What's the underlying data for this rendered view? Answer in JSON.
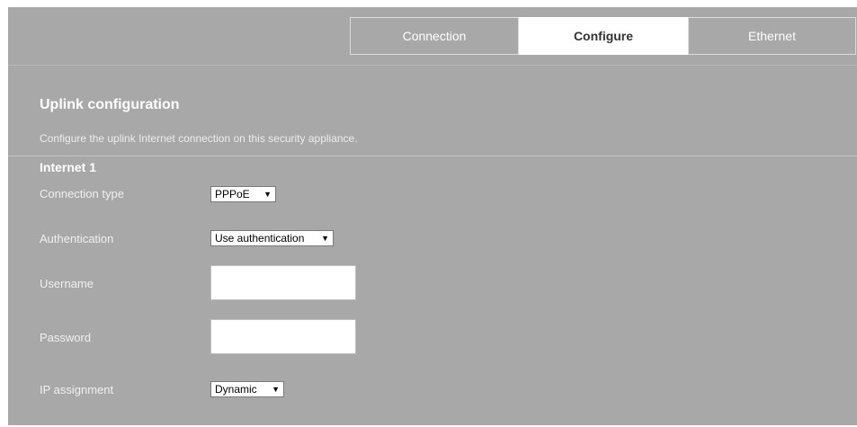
{
  "tabs": [
    {
      "label": "Connection"
    },
    {
      "label": "Configure"
    },
    {
      "label": "Ethernet"
    }
  ],
  "active_tab": "Configure",
  "page": {
    "title": "Uplink configuration",
    "description": "Configure the uplink Internet connection on this security appliance."
  },
  "section": {
    "title": "Internet 1"
  },
  "fields": {
    "connection_type": {
      "label": "Connection type",
      "value": "PPPoE"
    },
    "authentication": {
      "label": "Authentication",
      "value": "Use authentication"
    },
    "username": {
      "label": "Username",
      "value": ""
    },
    "password": {
      "label": "Password",
      "value": ""
    },
    "ip_assignment": {
      "label": "IP assignment",
      "value": "Dynamic"
    }
  },
  "icons": {
    "dropdown": "triangle-down-icon"
  },
  "colors": {
    "panel_bg": "#a8a8a8",
    "active_tab_bg": "#ffffff",
    "text": "#ffffff"
  }
}
